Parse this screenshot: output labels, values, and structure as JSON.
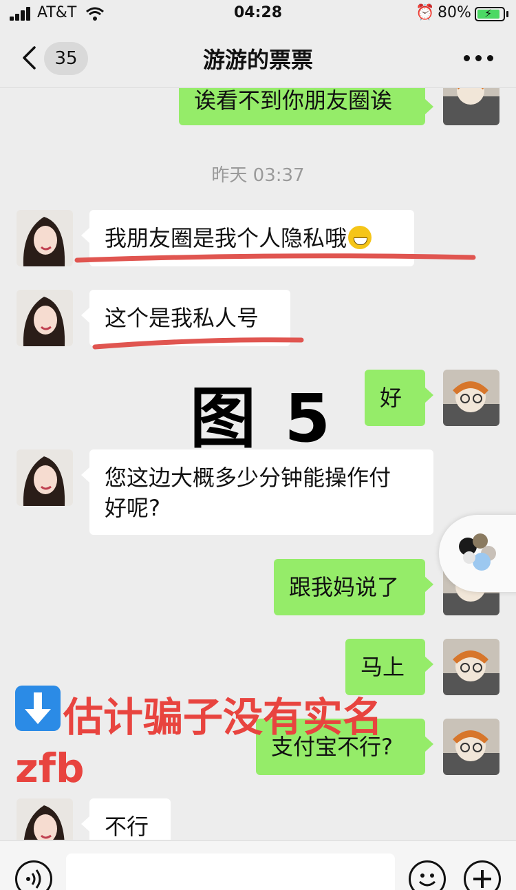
{
  "status_bar": {
    "carrier": "AT&T",
    "time": "04:28",
    "battery_percent": "80%",
    "battery_level": 0.8,
    "icons": [
      "signal-icon",
      "wifi-icon",
      "alarm-icon",
      "battery-charging-icon"
    ]
  },
  "header": {
    "unread_count": "35",
    "title": "游游的票票",
    "icons": [
      "back-icon",
      "more-icon"
    ]
  },
  "messages": [
    {
      "side": "right",
      "text": "诶看不到你朋友圈诶"
    },
    {
      "type": "timestamp",
      "text": "昨天 03:37"
    },
    {
      "side": "left",
      "text": "我朋友圈是我个人隐私哦",
      "emoji": "grinning-emoji"
    },
    {
      "side": "left",
      "text": "这个是我私人号"
    },
    {
      "side": "right",
      "text": "好"
    },
    {
      "side": "left",
      "text_line1": "您这边大概多少分钟能操作付",
      "text_line2": "好呢?"
    },
    {
      "side": "right",
      "text": "跟我妈说了"
    },
    {
      "side": "right",
      "text": "马上"
    },
    {
      "side": "right",
      "text": "支付宝不行?"
    },
    {
      "side": "left",
      "text": "不行"
    }
  ],
  "overlay": {
    "figure_label": "图 5",
    "note": "估计骗子没有实名",
    "note_line2": "zfb",
    "annotation_color": "#e8443f",
    "arrow_color": "#2b8be6"
  },
  "input_bar": {
    "icons": [
      "voice-icon",
      "emoji-icon",
      "plus-icon"
    ]
  },
  "colors": {
    "background": "#ededed",
    "outgoing_bubble": "#95ec69",
    "incoming_bubble": "#ffffff"
  }
}
